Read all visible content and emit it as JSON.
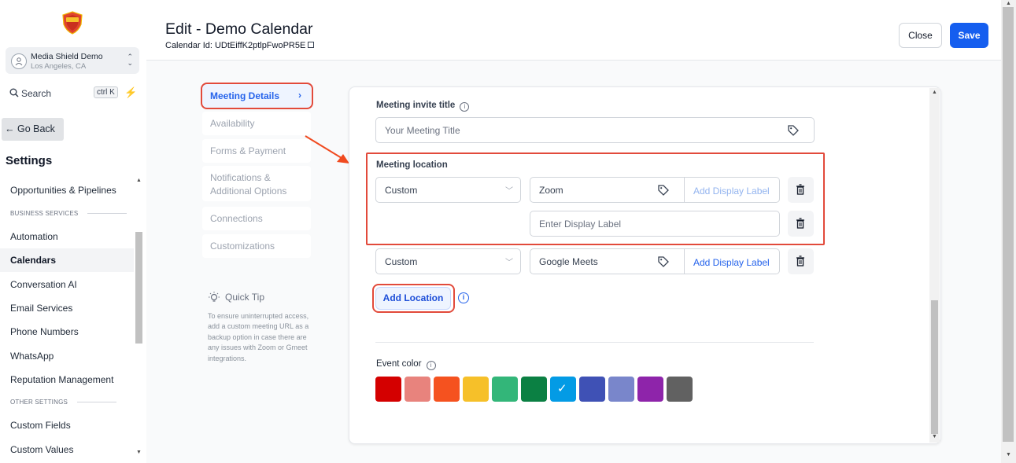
{
  "account": {
    "name": "Media Shield Demo",
    "location": "Los Angeles, CA"
  },
  "search": {
    "label": "Search",
    "shortcut": "ctrl K"
  },
  "sidebar": {
    "go_back": "← Go Back",
    "heading": "Settings",
    "items": [
      "Opportunities & Pipelines",
      "BUSINESS SERVICES",
      "Automation",
      "Calendars",
      "Conversation AI",
      "Email Services",
      "Phone Numbers",
      "WhatsApp",
      "Reputation Management",
      "OTHER SETTINGS",
      "Custom Fields",
      "Custom Values"
    ],
    "active": "Calendars"
  },
  "header": {
    "title": "Edit - Demo Calendar",
    "calendar_id": "Calendar Id: UDtEiffK2ptlpFwoPR5E",
    "close": "Close",
    "save": "Save"
  },
  "steps": [
    "Meeting Details",
    "Availability",
    "Forms & Payment",
    "Notifications & Additional Options",
    "Connections",
    "Customizations"
  ],
  "quick_tip": {
    "title": "Quick Tip",
    "text": "To ensure uninterrupted access, add a custom meeting URL as a backup option in case there are any issues with Zoom or Gmeet integrations."
  },
  "form": {
    "invite_title_label": "Meeting invite title",
    "invite_title_placeholder": "Your Meeting Title",
    "location_label": "Meeting location",
    "locations": [
      {
        "type": "Custom",
        "value": "Zoom",
        "display_label_button": "Add Display Label",
        "display_label_placeholder": "Enter Display Label"
      },
      {
        "type": "Custom",
        "value": "Google Meets",
        "display_label_button": "Add Display Label"
      }
    ],
    "add_location": "Add Location",
    "event_color_label": "Event color",
    "colors": [
      "#d40000",
      "#e8837d",
      "#f5521f",
      "#f6c029",
      "#33b679",
      "#0b8043",
      "#039be5",
      "#3f51b5",
      "#7986cb",
      "#8e24aa",
      "#616161"
    ],
    "selected_color": "#039be5"
  },
  "accent_color": "#155eef",
  "highlight_color": "#e24a3b"
}
